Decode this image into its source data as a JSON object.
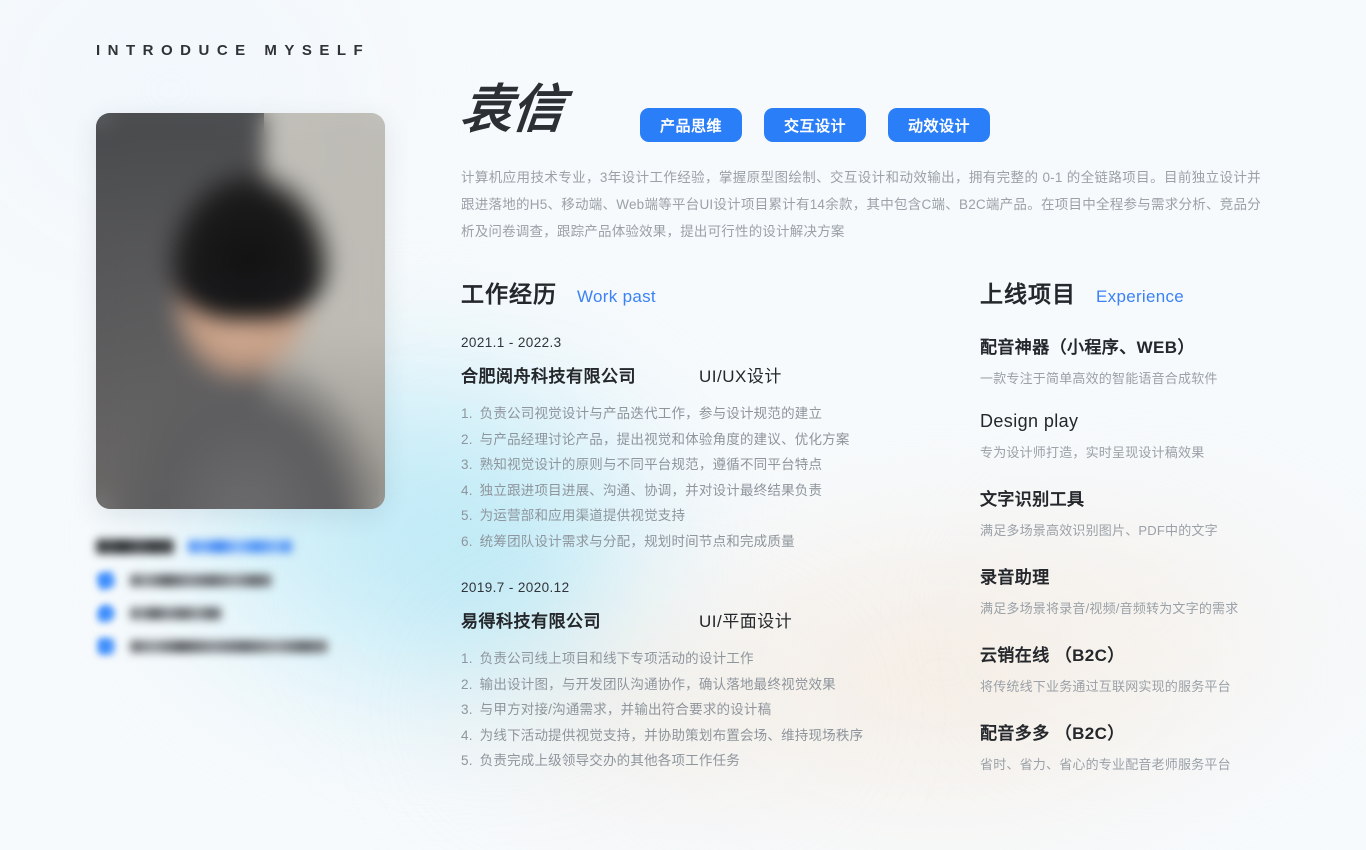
{
  "kicker": "INTRODUCE MYSELF",
  "profile": {
    "name": "袁信",
    "tags": [
      "产品思维",
      "交互设计",
      "动效设计"
    ],
    "intro": "计算机应用技术专业，3年设计工作经验，掌握原型图绘制、交互设计和动效输出，拥有完整的 0-1 的全链路项目。目前独立设计并跟进落地的H5、移动端、Web端等平台UI设计项目累计有14余款，其中包含C端、B2C端产品。在项目中全程参与需求分析、竞品分析及问卷调查，跟踪产品体验效果，提出可行性的设计解决方案"
  },
  "contact": {
    "name_redacted": "▇▇▇▇",
    "title_redacted": "▇▇▇▇▇▇▇",
    "rows": [
      {
        "icon": "phone-icon",
        "value_redacted": "▇▇▇ ▇▇▇▇ ▇▇▇▇"
      },
      {
        "icon": "wechat-icon",
        "value_redacted": "▇▇▇▇▇▇▇"
      },
      {
        "icon": "mail-icon",
        "value_redacted": "▇▇▇▇▇▇▇▇▇▇▇▇▇▇"
      }
    ]
  },
  "work": {
    "heading_cn": "工作经历",
    "heading_en": "Work past",
    "jobs": [
      {
        "date": "2021.1 - 2022.3",
        "company": "合肥阅舟科技有限公司",
        "role": "UI/UX设计",
        "duties": [
          "负责公司视觉设计与产品迭代工作，参与设计规范的建立",
          "与产品经理讨论产品，提出视觉和体验角度的建议、优化方案",
          "熟知视觉设计的原则与不同平台规范，遵循不同平台特点",
          "独立跟进项目进展、沟通、协调，并对设计最终结果负责",
          "为运营部和应用渠道提供视觉支持",
          "统筹团队设计需求与分配，规划时间节点和完成质量"
        ]
      },
      {
        "date": "2019.7 - 2020.12",
        "company": "易得科技有限公司",
        "role": "UI/平面设计",
        "duties": [
          "负责公司线上项目和线下专项活动的设计工作",
          "输出设计图，与开发团队沟通协作，确认落地最终视觉效果",
          "与甲方对接/沟通需求，并输出符合要求的设计稿",
          "为线下活动提供视觉支持，并协助策划布置会场、维持现场秩序",
          "负责完成上级领导交办的其他各项工作任务"
        ]
      }
    ]
  },
  "projects": {
    "heading_cn": "上线项目",
    "heading_en": "Experience",
    "items": [
      {
        "title": "配音神器（小程序、WEB）",
        "desc": "一款专注于简单高效的智能语音合成软件",
        "latin": false
      },
      {
        "title": "Design play",
        "desc": "专为设计师打造，实时呈现设计稿效果",
        "latin": true
      },
      {
        "title": "文字识别工具",
        "desc": "满足多场景高效识别图片、PDF中的文字",
        "latin": false
      },
      {
        "title": "录音助理",
        "desc": "满足多场景将录音/视频/音频转为文字的需求",
        "latin": false
      },
      {
        "title": "云销在线 （B2C）",
        "desc": "将传统线下业务通过互联网实现的服务平台",
        "latin": false
      },
      {
        "title": "配音多多 （B2C）",
        "desc": "省时、省力、省心的专业配音老师服务平台",
        "latin": false
      }
    ]
  },
  "colors": {
    "accent_blue": "#2a7ef7",
    "link_blue": "#3b82f6",
    "text_dark": "#24272b",
    "text_muted": "#9aa1a8",
    "background": "#f7fafc",
    "glow_cyan": "#b0e6f5",
    "glow_warm": "#f3e9de"
  }
}
